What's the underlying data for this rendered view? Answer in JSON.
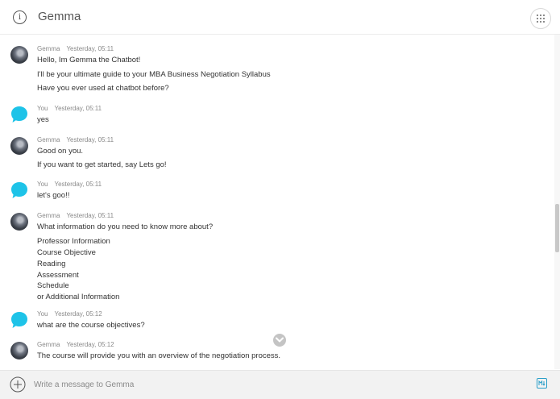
{
  "header": {
    "title": "Gemma",
    "info_icon": "info-icon",
    "menu_icon": "grid-dots-icon"
  },
  "messages": [
    {
      "sender": "Gemma",
      "time": "Yesterday, 05:11",
      "avatar": "bot",
      "lines": [
        "Hello, Im Gemma the Chatbot!",
        "I'll be your ultimate guide to your MBA Business Negotiation Syllabus",
        "Have you ever used at chatbot before?"
      ]
    },
    {
      "sender": "You",
      "time": "Yesterday, 05:11",
      "avatar": "user",
      "lines": [
        "yes"
      ]
    },
    {
      "sender": "Gemma",
      "time": "Yesterday, 05:11",
      "avatar": "bot",
      "lines": [
        "Good on you.",
        "If you want to get started, say Lets go!"
      ]
    },
    {
      "sender": "You",
      "time": "Yesterday, 05:11",
      "avatar": "user",
      "lines": [
        "let's goo!!"
      ]
    },
    {
      "sender": "Gemma",
      "time": "Yesterday, 05:11",
      "avatar": "bot",
      "lines": [
        "What information do you need to know more about?",
        "Professor Information",
        "Course Objective",
        "Reading",
        "Assessment",
        "Schedule",
        "or Additional Information"
      ]
    },
    {
      "sender": "You",
      "time": "Yesterday, 05:12",
      "avatar": "user",
      "lines": [
        "what are the course objectives?"
      ]
    },
    {
      "sender": "Gemma",
      "time": "Yesterday, 05:12",
      "avatar": "bot",
      "lines": [
        "The course will provide you with an overview of the negotiation process."
      ]
    }
  ],
  "composer": {
    "placeholder": "Write a message to Gemma",
    "add_icon": "plus-icon",
    "markdown_icon": "markdown-icon"
  },
  "colors": {
    "user_avatar": "#1ec3e8",
    "accent": "#2a9fc9"
  }
}
